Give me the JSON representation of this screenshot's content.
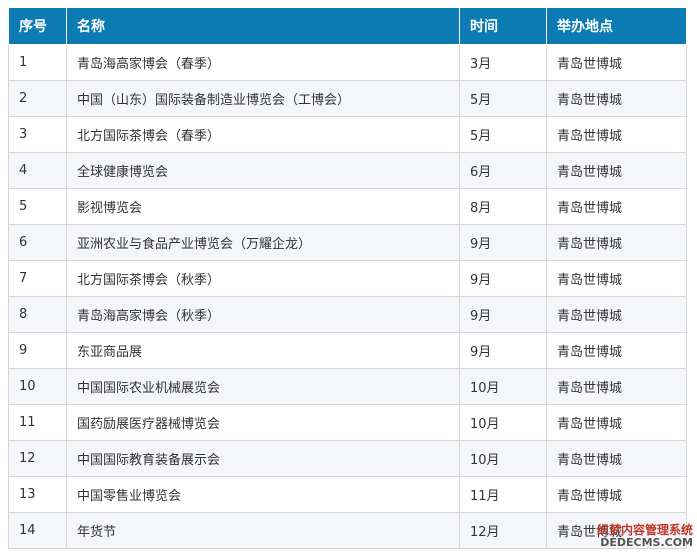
{
  "table": {
    "headers": [
      "序号",
      "名称",
      "时间",
      "举办地点"
    ],
    "rows": [
      [
        "1",
        "青岛海高家博会（春季）",
        "3月",
        "青岛世博城"
      ],
      [
        "2",
        "中国（山东）国际装备制造业博览会（工博会）",
        "5月",
        "青岛世博城"
      ],
      [
        "3",
        "北方国际茶博会（春季）",
        "5月",
        "青岛世博城"
      ],
      [
        "4",
        "全球健康博览会",
        "6月",
        "青岛世博城"
      ],
      [
        "5",
        "影视博览会",
        "8月",
        "青岛世博城"
      ],
      [
        "6",
        "亚洲农业与食品产业博览会（万耀企龙）",
        "9月",
        "青岛世博城"
      ],
      [
        "7",
        "北方国际茶博会（秋季）",
        "9月",
        "青岛世博城"
      ],
      [
        "8",
        "青岛海高家博会（秋季）",
        "9月",
        "青岛世博城"
      ],
      [
        "9",
        "东亚商品展",
        "9月",
        "青岛世博城"
      ],
      [
        "10",
        "中国国际农业机械展览会",
        "10月",
        "青岛世博城"
      ],
      [
        "11",
        "国药励展医疗器械博览会",
        "10月",
        "青岛世博城"
      ],
      [
        "12",
        "中国国际教育装备展示会",
        "10月",
        "青岛世博城"
      ],
      [
        "13",
        "中国零售业博览会",
        "11月",
        "青岛世博城"
      ],
      [
        "14",
        "年货节",
        "12月",
        "青岛世博城"
      ]
    ]
  },
  "watermark": {
    "line1": "织梦内容管理系统",
    "line2": "DEDECMS.COM"
  },
  "colors": {
    "header_bg": "#0c7bb3",
    "header_text": "#ffffff",
    "row_alt_bg": "#f4f6f9",
    "border": "#d6d6d6"
  }
}
